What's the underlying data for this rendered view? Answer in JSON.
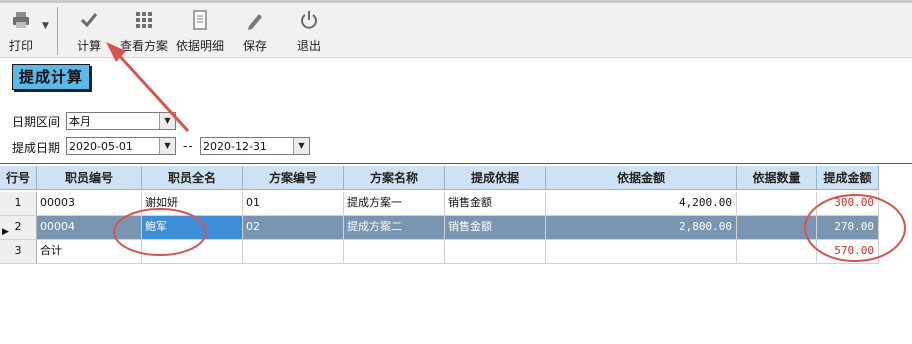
{
  "toolbar": {
    "print_label": "打印",
    "calc_label": "计算",
    "view_label": "查看方案",
    "detail_label": "依据明细",
    "save_label": "保存",
    "exit_label": "退出"
  },
  "title": "提成计算",
  "filters": {
    "period_label": "日期区间",
    "period_value": "本月",
    "date_label": "提成日期",
    "date_from": "2020-05-01",
    "date_sep": "--",
    "date_to": "2020-12-31"
  },
  "grid": {
    "headers": [
      "行号",
      "职员编号",
      "职员全名",
      "方案编号",
      "方案名称",
      "提成依据",
      "依据金额",
      "依据数量",
      "提成金额"
    ],
    "rows": [
      {
        "row": "1",
        "emp_id": "00003",
        "emp_name": "谢如妍",
        "plan_id": "01",
        "plan_name": "提成方案一",
        "basis": "销售金额",
        "basis_amount": "4,200.00",
        "basis_qty": "",
        "commission": "300.00"
      },
      {
        "row": "2",
        "emp_id": "00004",
        "emp_name": "鲍军",
        "plan_id": "02",
        "plan_name": "提成方案二",
        "basis": "销售金额",
        "basis_amount": "2,800.00",
        "basis_qty": "",
        "commission": "270.00"
      },
      {
        "row": "3",
        "emp_id": "合计",
        "emp_name": "",
        "plan_id": "",
        "plan_name": "",
        "basis": "",
        "basis_amount": "",
        "basis_qty": "",
        "commission": "570.00"
      }
    ],
    "selected_row": 2
  },
  "colors": {
    "header_bg": "#cfe2f3",
    "selected_row": "#7a95b1",
    "focus_cell": "#3d8ed6",
    "annotation": "#d9534f",
    "title_bg": "#5ab9e8"
  }
}
